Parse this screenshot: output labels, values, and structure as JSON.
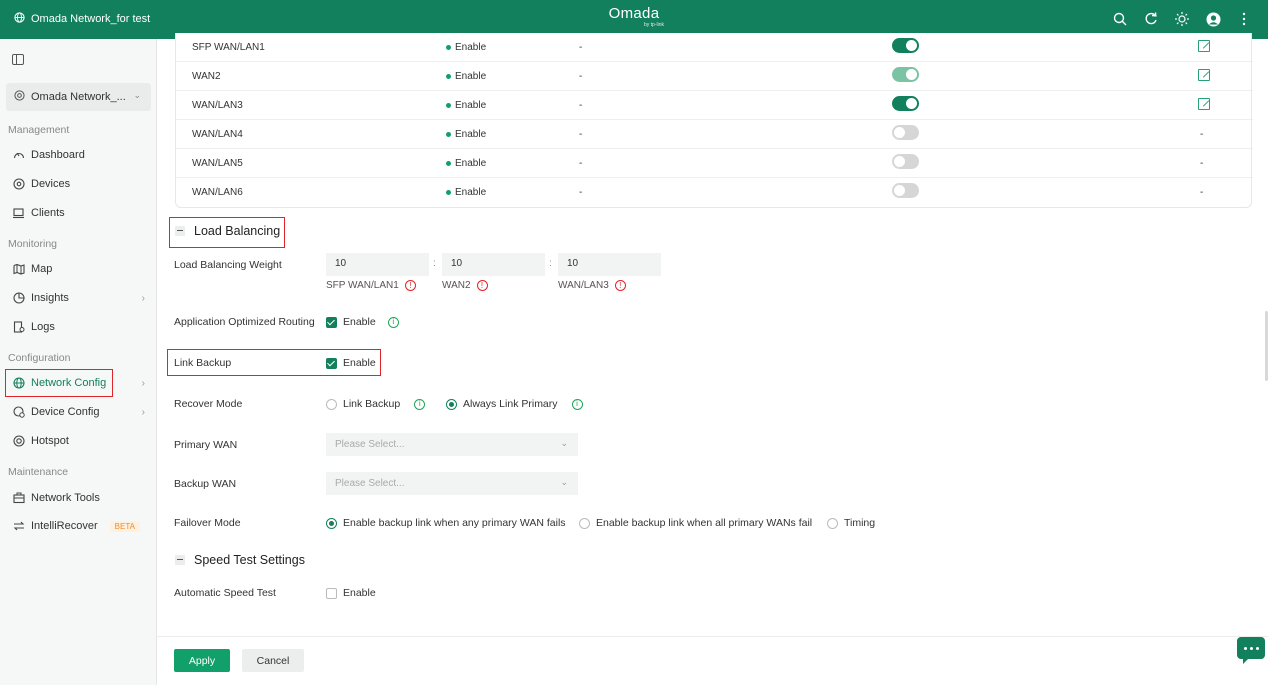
{
  "header": {
    "site_name": "Omada Network_for test",
    "brand": "Omada",
    "brand_sub": "by tp-link",
    "icons": [
      "search-icon",
      "refresh-icon",
      "theme-icon",
      "avatar-icon",
      "more-icon"
    ]
  },
  "sidebar": {
    "site_select": "Omada Network_...",
    "sections": {
      "management": "Management",
      "monitoring": "Monitoring",
      "configuration": "Configuration",
      "maintenance": "Maintenance"
    },
    "items": {
      "dashboard": "Dashboard",
      "devices": "Devices",
      "clients": "Clients",
      "map": "Map",
      "insights": "Insights",
      "logs": "Logs",
      "network_config": "Network Config",
      "device_config": "Device Config",
      "hotspot": "Hotspot",
      "network_tools": "Network Tools",
      "intellirecover": "IntelliRecover",
      "beta": "BETA"
    }
  },
  "wan_table": {
    "rows": [
      {
        "name": "SFP WAN/LAN1",
        "status": "Enable",
        "col3": "-",
        "toggle": "on"
      },
      {
        "name": "WAN2",
        "status": "Enable",
        "col3": "-",
        "toggle": "dim"
      },
      {
        "name": "WAN/LAN3",
        "status": "Enable",
        "col3": "-",
        "toggle": "on"
      },
      {
        "name": "WAN/LAN4",
        "status": "Enable",
        "col3": "-",
        "toggle": "off",
        "action": "-"
      },
      {
        "name": "WAN/LAN5",
        "status": "Enable",
        "col3": "-",
        "toggle": "off",
        "action": "-"
      },
      {
        "name": "WAN/LAN6",
        "status": "Enable",
        "col3": "-",
        "toggle": "off",
        "action": "-"
      }
    ]
  },
  "load_balancing": {
    "title": "Load Balancing",
    "weight_label": "Load Balancing Weight",
    "weights": [
      {
        "value": "10",
        "label": "SFP WAN/LAN1"
      },
      {
        "value": "10",
        "label": "WAN2"
      },
      {
        "value": "10",
        "label": "WAN/LAN3"
      }
    ],
    "colon": ":",
    "app_routing_label": "Application Optimized Routing",
    "app_routing_option": "Enable",
    "link_backup_label": "Link Backup",
    "link_backup_option": "Enable",
    "recover_mode_label": "Recover Mode",
    "recover_options": [
      "Link Backup",
      "Always Link Primary"
    ],
    "primary_wan_label": "Primary WAN",
    "primary_wan_placeholder": "Please Select...",
    "backup_wan_label": "Backup WAN",
    "backup_wan_placeholder": "Please Select...",
    "failover_label": "Failover Mode",
    "failover_options": [
      "Enable backup link when any primary WAN fails",
      "Enable backup link when all primary WANs fail",
      "Timing"
    ]
  },
  "speed_test": {
    "title": "Speed Test Settings",
    "auto_label": "Automatic Speed Test",
    "auto_option": "Enable"
  },
  "footer": {
    "apply": "Apply",
    "cancel": "Cancel"
  },
  "colors": {
    "brand": "#12805c",
    "accent": "#12a06a",
    "highlight": "#e0252a"
  }
}
